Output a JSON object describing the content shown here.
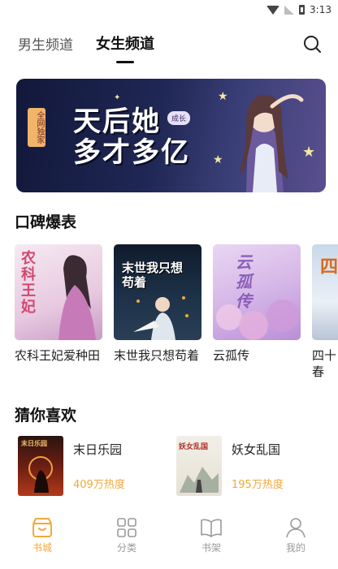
{
  "status": {
    "time": "3:13"
  },
  "tabs": [
    {
      "label": "男生频道"
    },
    {
      "label": "女生频道"
    }
  ],
  "banner": {
    "title_line1": "天后她",
    "title_line2": "多才多亿",
    "tag": "全网独家",
    "seal": "成长"
  },
  "sections": {
    "koubei": "口碑爆表",
    "guess": "猜你喜欢"
  },
  "koubei_books": [
    {
      "title": "农科王妃爱种田",
      "cover_text": "农科王妃"
    },
    {
      "title": "末世我只想苟着",
      "cover_text": "末世我只想苟着"
    },
    {
      "title": "云孤传",
      "cover_text": "云孤传"
    },
    {
      "title": "四十春",
      "cover_text": "四十"
    }
  ],
  "guess_books": [
    {
      "title": "末日乐园",
      "heat": "409万热度",
      "cover_text": "末日乐园"
    },
    {
      "title": "妖女乱国",
      "heat": "195万热度",
      "cover_text": "妖女乱国"
    }
  ],
  "bottom_nav": [
    {
      "label": "书城",
      "icon": "bookstore-icon",
      "active": true
    },
    {
      "label": "分类",
      "icon": "category-grid-icon",
      "active": false
    },
    {
      "label": "书架",
      "icon": "bookshelf-icon",
      "active": false
    },
    {
      "label": "我的",
      "icon": "profile-icon",
      "active": false
    }
  ],
  "colors": {
    "accent": "#f2a93b",
    "banner_bg": "#1f2754",
    "text": "#222222"
  }
}
